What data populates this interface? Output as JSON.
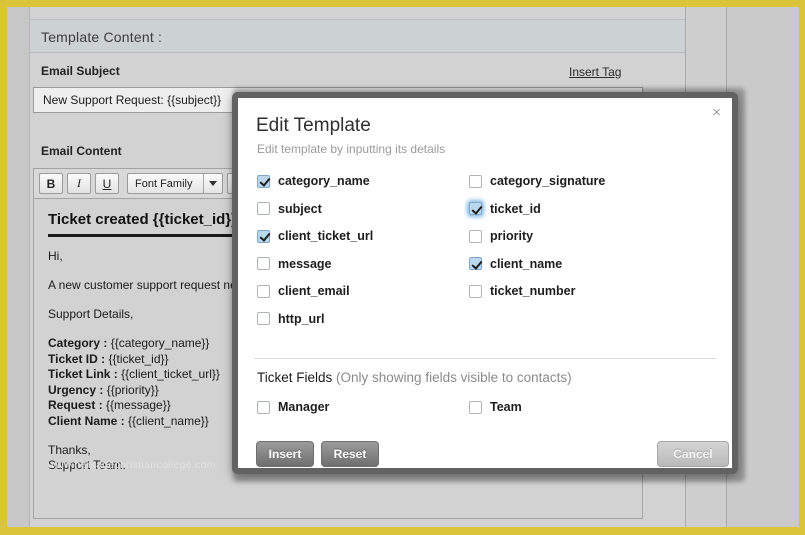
{
  "page": {
    "panel_header": "Template Content :",
    "email_subject_label": "Email Subject",
    "insert_tag_link": "Insert Tag",
    "subject_value": "New Support Request: {{subject}} ",
    "email_content_label": "Email Content",
    "toolbar": {
      "bold": "B",
      "italic": "I",
      "underline": "U",
      "font_family": "Font Family"
    },
    "mail": {
      "heading": "Ticket created {{ticket_id}}",
      "greeting": "Hi,",
      "intro": "A new customer support request ne",
      "details_heading": "Support Details,",
      "details": [
        {
          "key": "Category :",
          "value": "{{category_name}}"
        },
        {
          "key": "Ticket ID :",
          "value": "{{ticket_id}}"
        },
        {
          "key": "Ticket Link :",
          "value": "{{client_ticket_url}}"
        },
        {
          "key": "Urgency :",
          "value": "{{priority}}"
        },
        {
          "key": "Request :",
          "value": "{{message}}"
        },
        {
          "key": "Client Name :",
          "value": "{{client_name}}"
        }
      ],
      "sign_off_1": "Thanks,",
      "sign_off_2": "Support Team.",
      "watermark": "www.heritagechristiancollege.com"
    }
  },
  "dialog": {
    "title": "Edit Template",
    "subtitle": "Edit template by inputting its details",
    "close_label": "×",
    "tags": [
      {
        "label": "category_name",
        "checked": true,
        "focused": false
      },
      {
        "label": "category_signature",
        "checked": false,
        "focused": false
      },
      {
        "label": "subject",
        "checked": false,
        "focused": false
      },
      {
        "label": "ticket_id",
        "checked": true,
        "focused": true
      },
      {
        "label": "client_ticket_url",
        "checked": true,
        "focused": false
      },
      {
        "label": "priority",
        "checked": false,
        "focused": false
      },
      {
        "label": "message",
        "checked": false,
        "focused": false
      },
      {
        "label": "client_name",
        "checked": true,
        "focused": false
      },
      {
        "label": "client_email",
        "checked": false,
        "focused": false
      },
      {
        "label": "ticket_number",
        "checked": false,
        "focused": false
      },
      {
        "label": "http_url",
        "checked": false,
        "focused": false
      }
    ],
    "ticket_fields_heading": "Ticket Fields",
    "ticket_fields_note": "(Only showing fields visible to contacts)",
    "ticket_fields": [
      {
        "label": "Manager",
        "checked": false
      },
      {
        "label": "Team",
        "checked": false
      }
    ],
    "buttons": {
      "insert": "Insert",
      "reset": "Reset",
      "cancel": "Cancel"
    }
  },
  "colors": {
    "frame": "#d9c43a",
    "checkbox_checked": "#bad7ef",
    "focus_glow": "#5aa0dc"
  }
}
